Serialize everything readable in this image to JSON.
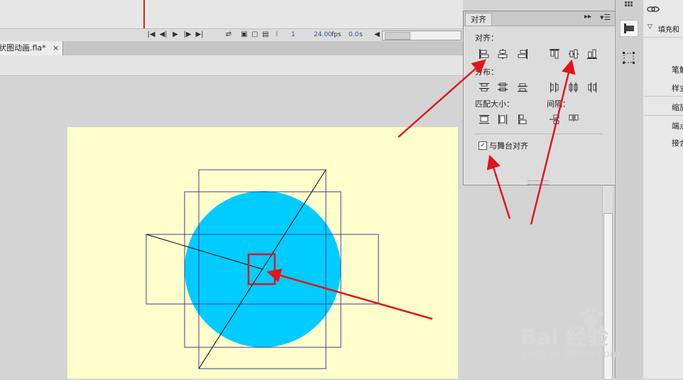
{
  "timeline": {
    "frame": "1",
    "fps": "24.00",
    "fps_unit": "fps",
    "time": "0.0",
    "time_unit": "s"
  },
  "document_tab": {
    "label": "状图动画.fla*",
    "close": "×"
  },
  "align_panel": {
    "tab": "对齐",
    "collapse": "▸▸",
    "menu": "▾☰",
    "align_label": "对齐：",
    "distribute_label": "分布：",
    "match_size_label": "匹配大小：",
    "space_label": "间隔：",
    "align_to_stage_checked": true,
    "align_to_stage_label": "与舞台对齐",
    "check_mark": "✓"
  },
  "properties_panel": {
    "fill_section": "填充和",
    "items": [
      "笔触",
      "样式",
      "缩放",
      "端点",
      "接合"
    ]
  },
  "watermark": {
    "main": "Bai 经验",
    "sub": "jingyan.baidu.com"
  },
  "colors": {
    "circle": "#00ccff",
    "stage": "#ffffcc",
    "bounding_box": "#3c3c9c",
    "annotation": "#e0161b"
  },
  "icons": {
    "timeline_controls": [
      "first-frame-icon",
      "step-back-icon",
      "play-icon",
      "step-forward-icon",
      "last-frame-icon",
      "loop-icon",
      "onion-skin-icon",
      "onion-outline-icon",
      "edit-multiple-icon",
      "onion-markers-icon"
    ],
    "align_row": [
      "align-left-edge-icon",
      "align-horizontal-center-icon",
      "align-right-edge-icon",
      "align-top-edge-icon",
      "align-vertical-center-icon",
      "align-bottom-edge-icon"
    ],
    "distribute_row": [
      "distribute-top-icon",
      "distribute-vertical-center-icon",
      "distribute-bottom-icon",
      "distribute-left-icon",
      "distribute-horizontal-center-icon",
      "distribute-right-icon"
    ],
    "match_size_row": [
      "match-width-icon",
      "match-height-icon",
      "match-width-height-icon"
    ],
    "space_row": [
      "space-evenly-vertical-icon",
      "space-evenly-horizontal-icon"
    ]
  }
}
